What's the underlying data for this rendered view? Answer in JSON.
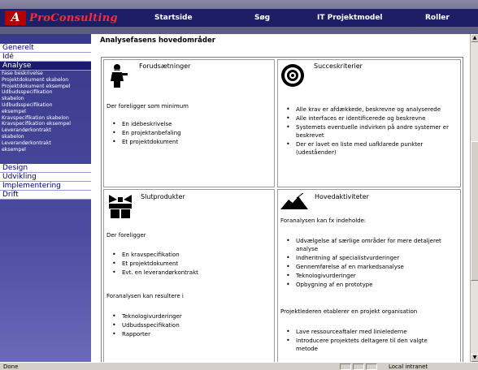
{
  "header": {
    "logo_mark": "A",
    "logo_text": "ProConsulting",
    "nav": [
      "Startside",
      "Søg",
      "IT Projektmodel",
      "Roller"
    ]
  },
  "sidebar": {
    "items": [
      {
        "label": "Generelt"
      },
      {
        "label": "Idé"
      },
      {
        "label": "Analyse"
      }
    ],
    "subitems": [
      "Fase beskrivelse",
      "Projektdokument skabelon",
      "Projektdokument eksempel",
      "Udbudsspecifikation",
      "skabelon",
      "Udbudsspecifikation",
      "eksempel",
      "Kravspecifikation skabelon",
      "Kravspecifikation eksempel",
      "Leverandørkontrakt",
      "skabelon",
      "Leverandørkontrakt",
      "eksempel"
    ],
    "bottom_items": [
      {
        "label": "Design"
      },
      {
        "label": "Udvikling"
      },
      {
        "label": "Implementering"
      },
      {
        "label": "Drift"
      }
    ]
  },
  "main": {
    "title": "Analysefasens hovedområder",
    "cells": [
      {
        "title": "Forudsætninger",
        "icon": "engineer-icon",
        "intro": "Der foreligger som minimum",
        "bullets": [
          "En idébeskrivelse",
          "En projektanbefaling",
          "Et projektdokument"
        ]
      },
      {
        "title": "Succeskriterier",
        "icon": "target-icon",
        "bullets": [
          "Alle krav er afdækkede, beskrevne og analyserede",
          "Alle interfaces er identificerede og beskrevne",
          "Systemets eventuelle indvirken på andre systemer er beskrevet",
          "Der er lavet en liste med uafklarede punkter (udeståender)"
        ]
      },
      {
        "title": "Slutprodukter",
        "icon": "gift-icon",
        "intro": "Der foreligger",
        "bullets": [
          "En kravspecifikation",
          "Et projektdokument",
          "Evt. en leverandørkontrakt"
        ],
        "intro2": "Foranalysen kan resultere i",
        "bullets2": [
          "Teknologivurderinger",
          "Udbudsspecifikation",
          "Rapporter"
        ]
      },
      {
        "title": "Hovedaktiviteter",
        "icon": "mountain-icon",
        "intro": "Foranalysen kan fx indeholde:",
        "bullets": [
          "Udvælgelse af særlige områder for mere detaljeret analyse",
          "Indhentning af specialistvurderinger",
          "Gennemførelse af en markedsanalyse",
          "Teknologivurderinger",
          "Opbygning af en prototype"
        ],
        "intro2": "Projektlederen etablerer en projekt organisation",
        "bullets2": [
          "Lave ressourceaftaler med linielederne",
          "Introducere projektets deltagere til den valgte metode"
        ]
      }
    ]
  },
  "statusbar": {
    "left": "Done",
    "right": "Local intranet"
  },
  "colors": {
    "header": "#1e1e66",
    "logo_red": "#ff2a2a",
    "sidebar": "#3a3a8a"
  }
}
